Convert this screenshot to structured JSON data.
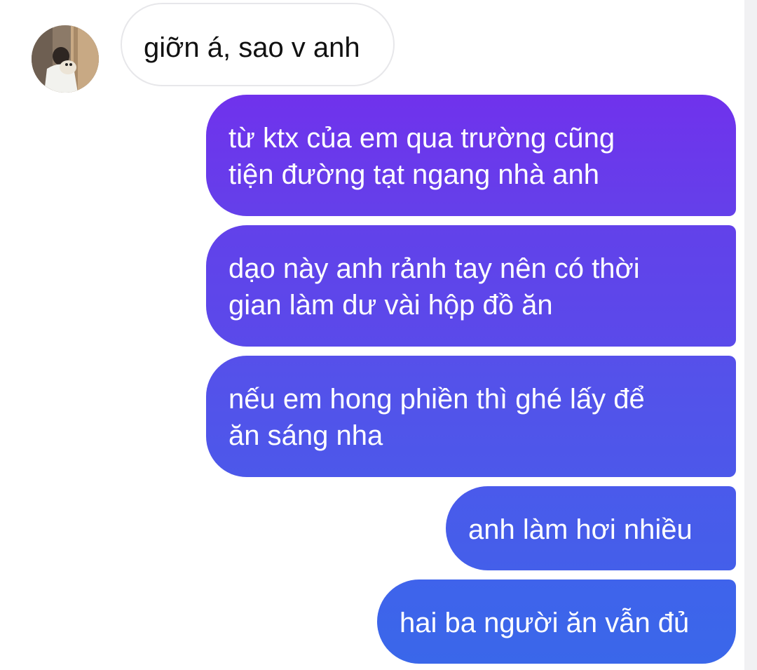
{
  "conversation": {
    "incoming": {
      "text": "giỡn á, sao v anh"
    },
    "outgoing": [
      {
        "lines": [
          "từ ktx của em qua trường cũng",
          "tiện đường tạt ngang nhà anh"
        ]
      },
      {
        "lines": [
          "dạo này anh rảnh tay nên có thời",
          "gian làm dư vài hộp đồ ăn"
        ]
      },
      {
        "lines": [
          "nếu em hong phiền thì ghé lấy để",
          "ăn sáng nha"
        ]
      },
      {
        "lines": [
          "anh làm hơi nhiều"
        ]
      },
      {
        "lines": [
          "hai ba người ăn vẫn đủ"
        ]
      }
    ]
  },
  "colors": {
    "outgoing_gradient_top": "#7032ec",
    "outgoing_gradient_bottom": "#3a67ea",
    "incoming_border": "#e7e7ea"
  }
}
